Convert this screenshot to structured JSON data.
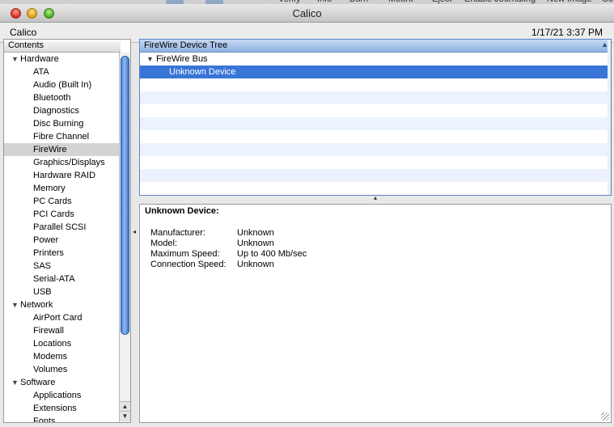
{
  "background_toolbar": [
    "Verify",
    "Info",
    "Burn",
    "Mount",
    "Eject",
    "Enable Journaling",
    "New Image",
    "Co"
  ],
  "window": {
    "title": "Calico"
  },
  "infobar": {
    "app_name": "Calico",
    "timestamp": "1/17/21 3:37 PM"
  },
  "sidebar": {
    "header": "Contents",
    "items": [
      {
        "label": "Hardware",
        "kind": "cat"
      },
      {
        "label": "ATA",
        "kind": "sub"
      },
      {
        "label": "Audio (Built In)",
        "kind": "sub"
      },
      {
        "label": "Bluetooth",
        "kind": "sub"
      },
      {
        "label": "Diagnostics",
        "kind": "sub"
      },
      {
        "label": "Disc Burning",
        "kind": "sub"
      },
      {
        "label": "Fibre Channel",
        "kind": "sub"
      },
      {
        "label": "FireWire",
        "kind": "sub",
        "selected": true
      },
      {
        "label": "Graphics/Displays",
        "kind": "sub"
      },
      {
        "label": "Hardware RAID",
        "kind": "sub"
      },
      {
        "label": "Memory",
        "kind": "sub"
      },
      {
        "label": "PC Cards",
        "kind": "sub"
      },
      {
        "label": "PCI Cards",
        "kind": "sub"
      },
      {
        "label": "Parallel SCSI",
        "kind": "sub"
      },
      {
        "label": "Power",
        "kind": "sub"
      },
      {
        "label": "Printers",
        "kind": "sub"
      },
      {
        "label": "SAS",
        "kind": "sub"
      },
      {
        "label": "Serial-ATA",
        "kind": "sub"
      },
      {
        "label": "USB",
        "kind": "sub"
      },
      {
        "label": "Network",
        "kind": "cat"
      },
      {
        "label": "AirPort Card",
        "kind": "sub"
      },
      {
        "label": "Firewall",
        "kind": "sub"
      },
      {
        "label": "Locations",
        "kind": "sub"
      },
      {
        "label": "Modems",
        "kind": "sub"
      },
      {
        "label": "Volumes",
        "kind": "sub"
      },
      {
        "label": "Software",
        "kind": "cat"
      },
      {
        "label": "Applications",
        "kind": "sub"
      },
      {
        "label": "Extensions",
        "kind": "sub"
      },
      {
        "label": "Fonts",
        "kind": "sub"
      }
    ]
  },
  "device_tree": {
    "header": "FireWire Device Tree",
    "rows": [
      {
        "label": "FireWire Bus",
        "indent": 1,
        "expanded": true
      },
      {
        "label": "Unknown Device",
        "indent": 2,
        "selected": true
      }
    ],
    "empty_rows": 9
  },
  "detail": {
    "title": "Unknown Device:",
    "fields": [
      {
        "key": "Manufacturer:",
        "value": "Unknown"
      },
      {
        "key": "Model:",
        "value": "Unknown"
      },
      {
        "key": "Maximum Speed:",
        "value": "Up to 400 Mb/sec"
      },
      {
        "key": "Connection Speed:",
        "value": "Unknown"
      }
    ]
  },
  "colors": {
    "selection": "#3875d7",
    "scroll_thumb": "#4b83d1",
    "alt_row": "#edf3fe"
  }
}
